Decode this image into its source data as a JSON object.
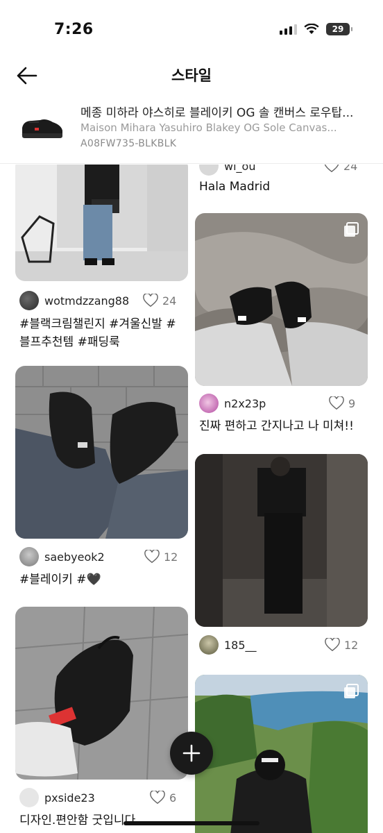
{
  "status_bar": {
    "time": "7:26",
    "battery": "29"
  },
  "header": {
    "title": "스타일"
  },
  "product": {
    "name_ko": "메종 미하라 야스히로 블레이키 OG 솔 캔버스 로우탑...",
    "name_en": "Maison Mihara Yasuhiro Blakey OG Sole Canvas...",
    "code": "A08FW735-BLKBLK"
  },
  "posts_left": [
    {
      "username": "wotmdzzang88",
      "likes": "24",
      "caption_lines": [
        "#블랙크림챌린지 #겨울신발 #",
        "블프추천템 #패딩룩"
      ]
    },
    {
      "username": "saebyeok2",
      "likes": "12",
      "caption_lines": [
        "#블레이키 #🖤"
      ]
    },
    {
      "username": "pxside23",
      "likes": "6",
      "caption_lines": [
        "디자인.편안함 굿입니다"
      ]
    }
  ],
  "posts_right": [
    {
      "username": "wl_ou",
      "likes": "24",
      "caption_lines": [
        "Hala Madrid"
      ]
    },
    {
      "username": "n2x23p",
      "likes": "9",
      "caption_lines": [
        "진짜 편하고 간지나고 나 미쳐!!"
      ]
    },
    {
      "username": "185__",
      "likes": "12",
      "caption_lines": []
    }
  ]
}
